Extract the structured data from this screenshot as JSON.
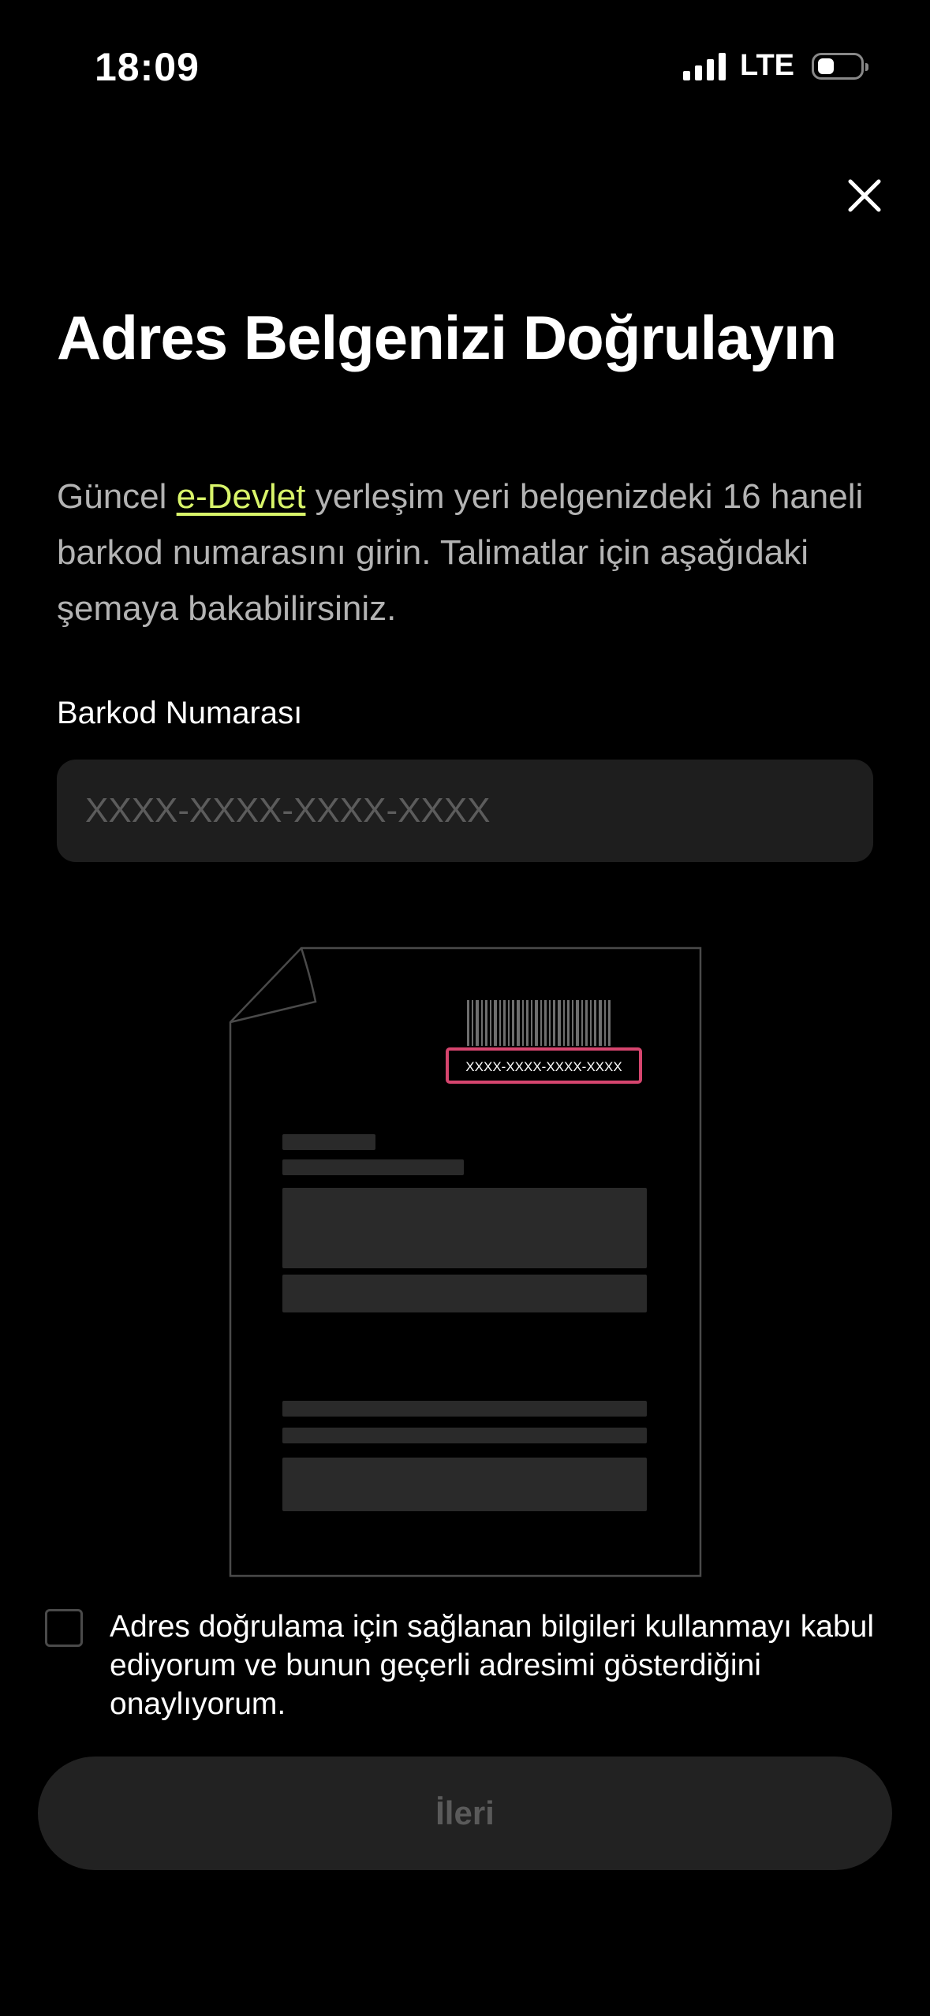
{
  "status_bar": {
    "time": "18:09",
    "network": "LTE",
    "icons": [
      "signal-icon",
      "battery-icon"
    ]
  },
  "header": {
    "close_icon": "close-icon"
  },
  "title": "Adres Belgenizi Doğrulayın",
  "description": {
    "prefix": "Güncel ",
    "link_text": "e-Devlet",
    "suffix": " yerleşim yeri belgenizdeki 16 haneli barkod numarasını girin. Talimatlar için aşağıdaki şemaya bakabilirsiniz."
  },
  "barcode": {
    "label": "Barkod Numarası",
    "placeholder": "XXXX-XXXX-XXXX-XXXX",
    "value": ""
  },
  "illustration": {
    "barcode_text": "XXXX-XXXX-XXXX-XXXX"
  },
  "consent": {
    "checked": false,
    "text": "Adres doğrulama için sağlanan bilgileri kullanmayı kabul ediyorum ve bunun geçerli adresimi gösterdiğini onaylıyorum."
  },
  "next_button": {
    "label": "İleri",
    "enabled": false
  },
  "colors": {
    "background": "#000000",
    "link_accent": "#d9f56a",
    "highlight_border": "#d6456e",
    "input_background": "#1e1e1e",
    "button_background": "#222222"
  }
}
